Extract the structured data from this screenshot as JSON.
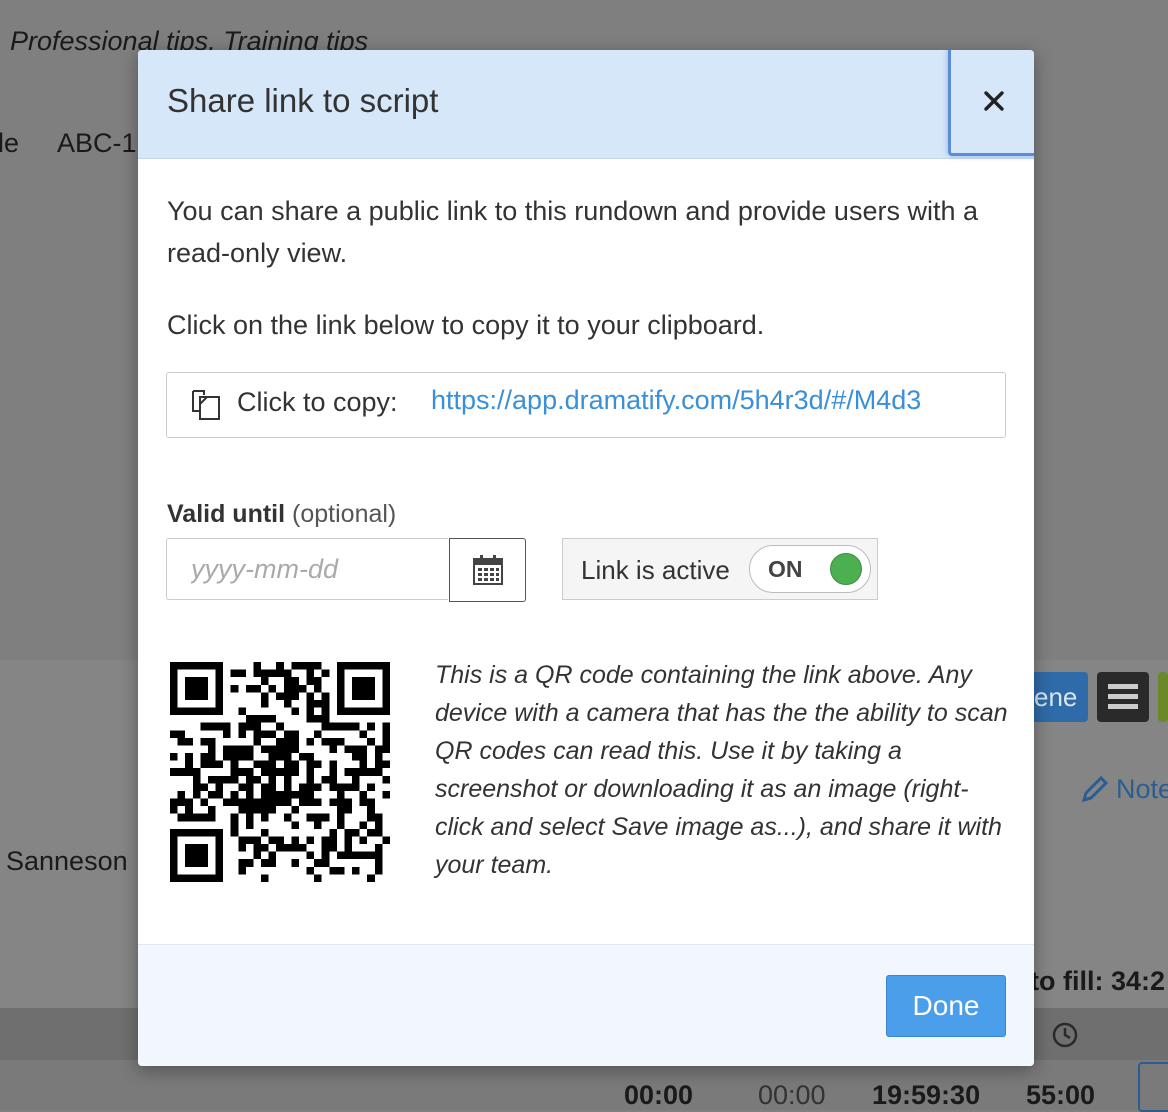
{
  "background": {
    "tips_line": "Professional tips, Training tips",
    "code_prefix": "le",
    "code": "ABC-1",
    "name": "Sanneson",
    "scene_btn": "ene",
    "note_link": "Note",
    "to_fill_label": "to fill: 34:2",
    "times": [
      "00:00",
      "00:00",
      "19:59:30",
      "55:00"
    ]
  },
  "modal": {
    "title": "Share link to script",
    "intro": "You can share a public link to this rundown and provide users with a read-only view.",
    "copy_instruction": "Click on the link below to copy it to your clipboard.",
    "copy_label": "Click to copy:",
    "link": "https://app.dramatify.com/5h4r3d/#/M4d3",
    "valid_until_label": "Valid until",
    "valid_until_optional": "(optional)",
    "date_placeholder": "yyyy-mm-dd",
    "link_active_label": "Link is active",
    "toggle_state": "ON",
    "qr_description": "This is a QR code containing the link above. Any device with a camera that has the the ability to scan QR codes can read this. Use it by taking a screenshot or downloading it as an image (right-click and select Save image as...), and share it with your team.",
    "done_label": "Done"
  },
  "colors": {
    "header_bg": "#d5e7f8",
    "link": "#3a8fd9",
    "primary": "#4a9eea",
    "toggle_on": "#4caf50"
  }
}
